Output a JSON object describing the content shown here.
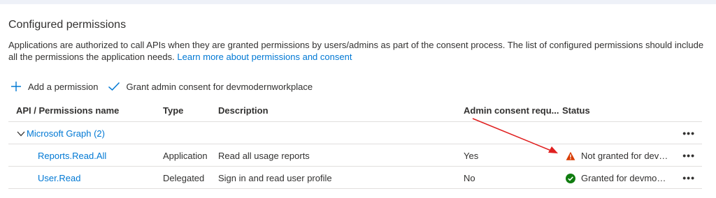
{
  "section": {
    "title": "Configured permissions",
    "description_line1": "Applications are authorized to call APIs when they are granted permissions by users/admins as part of the consent process. The list of configured permissions should include",
    "description_line2": "all the permissions the application needs.",
    "learn_more_link": "Learn more about permissions and consent"
  },
  "toolbar": {
    "add_label": "Add a permission",
    "grant_label": "Grant admin consent for devmodernworkplace"
  },
  "table": {
    "headers": {
      "api": "API / Permissions name",
      "type": "Type",
      "description": "Description",
      "admin": "Admin consent requ...",
      "status": "Status"
    },
    "group": {
      "label": "Microsoft Graph (2)"
    },
    "rows": [
      {
        "name": "Reports.Read.All",
        "type": "Application",
        "description": "Read all usage reports",
        "admin": "Yes",
        "status": "Not granted for devmo...",
        "status_icon": "warning-icon"
      },
      {
        "name": "User.Read",
        "type": "Delegated",
        "description": "Sign in and read user profile",
        "admin": "No",
        "status": "Granted for devmodern...",
        "status_icon": "check-circle-icon"
      }
    ],
    "more_glyph": "•••"
  },
  "colors": {
    "accent": "#0078d4",
    "warning": "#d83b01",
    "success": "#107c10",
    "annotation_arrow": "#e02020"
  }
}
